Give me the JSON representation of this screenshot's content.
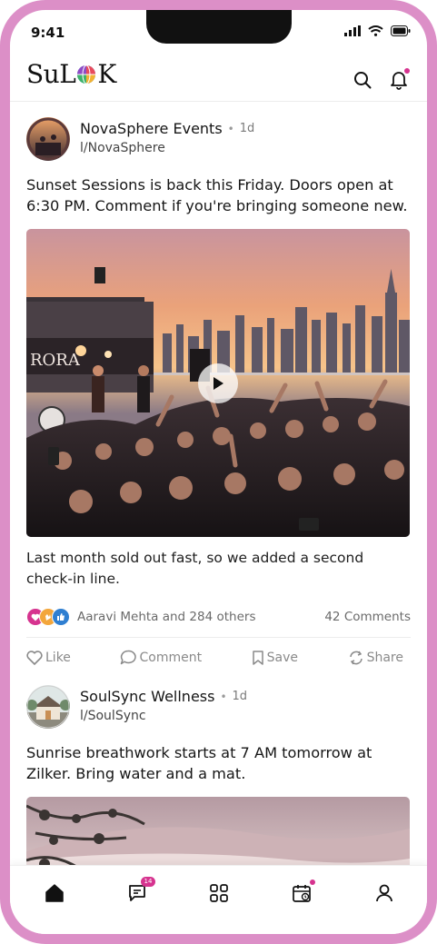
{
  "status_bar": {
    "time": "9:41"
  },
  "app": {
    "logo_prefix": "Su",
    "logo_suffix": "K",
    "brand_colors": {
      "accent": "#d6338f",
      "frame": "#dc8fc7"
    }
  },
  "posts": [
    {
      "author": "NovaSphere Events",
      "separator": "•",
      "age": "1d",
      "handle": "l/NovaSphere",
      "text": "Sunset Sessions is back this Friday. Doors open at 6:30 PM. Comment if you're bringing someone new.",
      "media_overlay": "RORA",
      "caption": "Last month sold out fast, so we added a second check-in line.",
      "reaction_names": "Aaravi Mehta and 284 others",
      "comments": "42 Comments",
      "actions": {
        "like": "Like",
        "comment": "Comment",
        "save": "Save",
        "share": "Share"
      }
    },
    {
      "author": "SoulSync Wellness",
      "separator": "•",
      "age": "1d",
      "handle": "l/SoulSync",
      "text": "Sunrise breathwork starts at 7 AM tomorrow at Zilker. Bring water and a mat."
    }
  ],
  "tab_bar": {
    "messages_badge": "14",
    "icons": [
      "home-icon",
      "messages-icon",
      "apps-icon",
      "calendar-icon",
      "profile-icon"
    ]
  }
}
